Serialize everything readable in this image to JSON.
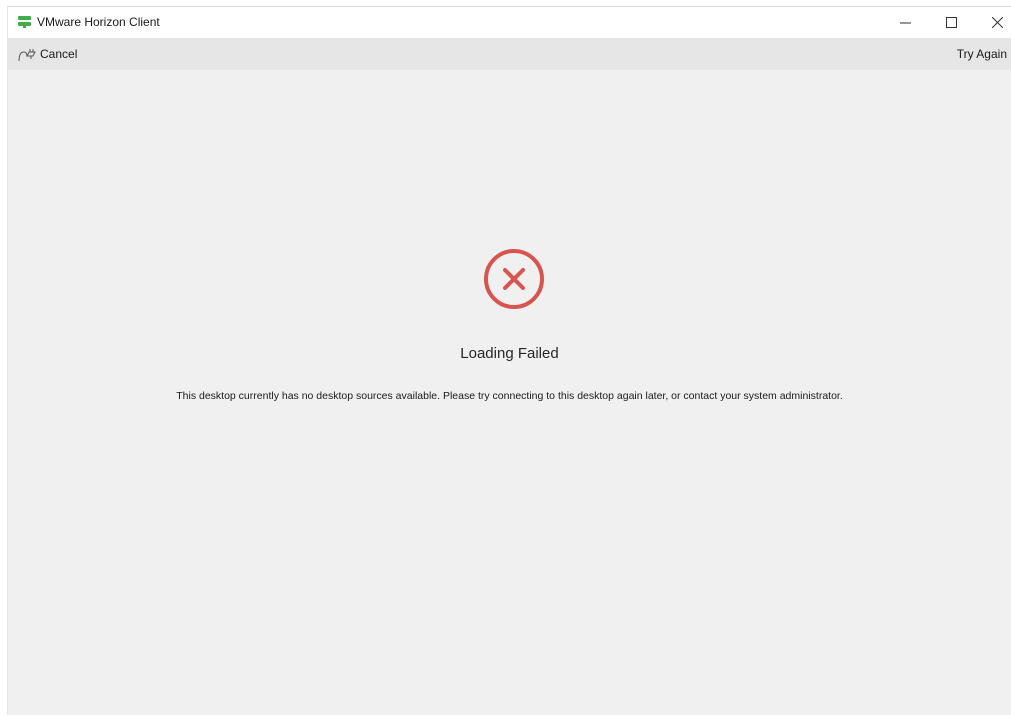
{
  "window": {
    "title": "VMware Horizon Client",
    "icon": "vmware-horizon-icon"
  },
  "toolbar": {
    "cancel_label": "Cancel",
    "cancel_icon": "disconnect-plug-icon",
    "try_again_label": "Try Again"
  },
  "error": {
    "icon": "error-x-circle-icon",
    "title": "Loading Failed",
    "message": "This desktop currently has no desktop sources available. Please try connecting to this desktop again later, or contact your system administrator."
  },
  "colors": {
    "error_red": "#d9534f",
    "brand_green": "#3fae49",
    "content_bg": "#f0f0f0",
    "toolbar_bg": "#e6e6e6"
  }
}
